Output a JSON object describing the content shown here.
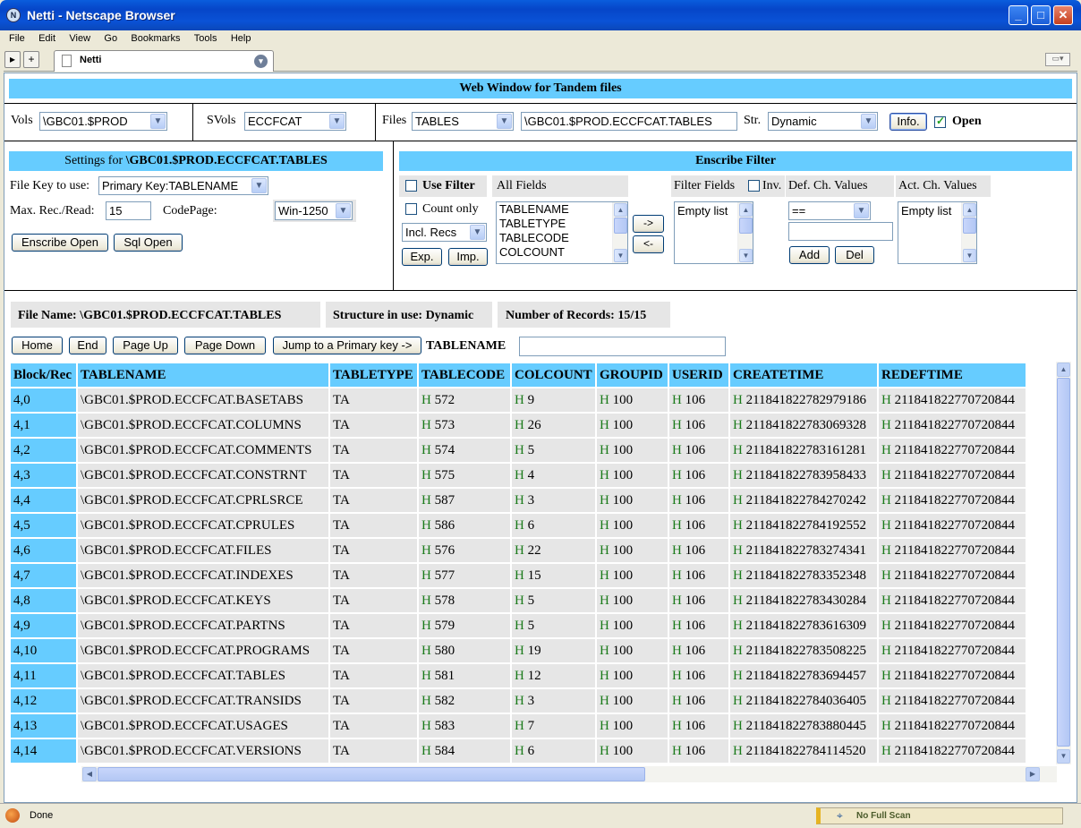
{
  "window": {
    "title": "Netti - Netscape Browser"
  },
  "menu": [
    "File",
    "Edit",
    "View",
    "Go",
    "Bookmarks",
    "Tools",
    "Help"
  ],
  "tab": {
    "label": "Netti"
  },
  "page": {
    "header": "Web Window for Tandem files",
    "vols": {
      "label": "Vols",
      "value": "\\GBC01.$PROD"
    },
    "svols": {
      "label": "SVols",
      "value": "ECCFCAT"
    },
    "files": {
      "label": "Files",
      "value": "TABLES",
      "path": "\\GBC01.$PROD.ECCFCAT.TABLES"
    },
    "structure": {
      "label": "Str.",
      "value": "Dynamic"
    },
    "info_label": "Info.",
    "open_label": "Open",
    "settings": {
      "title_prefix": "Settings for ",
      "title_file": "\\GBC01.$PROD.ECCFCAT.TABLES",
      "file_key_label": "File Key to use:",
      "file_key_value": "Primary Key:TABLENAME",
      "max_rec_label": "Max. Rec./Read:",
      "max_rec_value": "15",
      "codepage_label": "CodePage:",
      "codepage_value": "Win-1250",
      "enscribe_open": "Enscribe Open",
      "sql_open": "Sql Open"
    },
    "filter": {
      "title": "Enscribe Filter",
      "use_filter": "Use Filter",
      "all_fields": "All Fields",
      "count_only": "Count only",
      "incl_recs": "Incl. Recs",
      "exp": "Exp.",
      "imp": "Imp.",
      "fields": [
        "TABLENAME",
        "TABLETYPE",
        "TABLECODE",
        "COLCOUNT"
      ],
      "move_right": "->",
      "move_left": "<-",
      "filter_fields": "Filter Fields",
      "inv": "Inv.",
      "empty_list": "Empty list",
      "def_ch_values": "Def. Ch. Values",
      "operator": "==",
      "add": "Add",
      "del": "Del",
      "act_ch_values": "Act. Ch. Values"
    },
    "info_bar": {
      "file_name": "File Name: \\GBC01.$PROD.ECCFCAT.TABLES",
      "structure": "Structure in use: Dynamic",
      "records": "Number of Records: 15/15"
    },
    "nav": {
      "home": "Home",
      "end": "End",
      "page_up": "Page Up",
      "page_down": "Page Down",
      "jump": "Jump to a Primary key ->",
      "key_name": "TABLENAME"
    },
    "table": {
      "columns": [
        "Block/Rec",
        "TABLENAME",
        "TABLETYPE",
        "TABLECODE",
        "COLCOUNT",
        "GROUPID",
        "USERID",
        "CREATETIME",
        "REDEFTIME"
      ],
      "rows": [
        [
          "4,0",
          "\\GBC01.$PROD.ECCFCAT.BASETABS",
          "TA",
          "572",
          "9",
          "100",
          "106",
          "211841822782979186",
          "211841822770720844"
        ],
        [
          "4,1",
          "\\GBC01.$PROD.ECCFCAT.COLUMNS",
          "TA",
          "573",
          "26",
          "100",
          "106",
          "211841822783069328",
          "211841822770720844"
        ],
        [
          "4,2",
          "\\GBC01.$PROD.ECCFCAT.COMMENTS",
          "TA",
          "574",
          "5",
          "100",
          "106",
          "211841822783161281",
          "211841822770720844"
        ],
        [
          "4,3",
          "\\GBC01.$PROD.ECCFCAT.CONSTRNT",
          "TA",
          "575",
          "4",
          "100",
          "106",
          "211841822783958433",
          "211841822770720844"
        ],
        [
          "4,4",
          "\\GBC01.$PROD.ECCFCAT.CPRLSRCE",
          "TA",
          "587",
          "3",
          "100",
          "106",
          "211841822784270242",
          "211841822770720844"
        ],
        [
          "4,5",
          "\\GBC01.$PROD.ECCFCAT.CPRULES",
          "TA",
          "586",
          "6",
          "100",
          "106",
          "211841822784192552",
          "211841822770720844"
        ],
        [
          "4,6",
          "\\GBC01.$PROD.ECCFCAT.FILES",
          "TA",
          "576",
          "22",
          "100",
          "106",
          "211841822783274341",
          "211841822770720844"
        ],
        [
          "4,7",
          "\\GBC01.$PROD.ECCFCAT.INDEXES",
          "TA",
          "577",
          "15",
          "100",
          "106",
          "211841822783352348",
          "211841822770720844"
        ],
        [
          "4,8",
          "\\GBC01.$PROD.ECCFCAT.KEYS",
          "TA",
          "578",
          "5",
          "100",
          "106",
          "211841822783430284",
          "211841822770720844"
        ],
        [
          "4,9",
          "\\GBC01.$PROD.ECCFCAT.PARTNS",
          "TA",
          "579",
          "5",
          "100",
          "106",
          "211841822783616309",
          "211841822770720844"
        ],
        [
          "4,10",
          "\\GBC01.$PROD.ECCFCAT.PROGRAMS",
          "TA",
          "580",
          "19",
          "100",
          "106",
          "211841822783508225",
          "211841822770720844"
        ],
        [
          "4,11",
          "\\GBC01.$PROD.ECCFCAT.TABLES",
          "TA",
          "581",
          "12",
          "100",
          "106",
          "211841822783694457",
          "211841822770720844"
        ],
        [
          "4,12",
          "\\GBC01.$PROD.ECCFCAT.TRANSIDS",
          "TA",
          "582",
          "3",
          "100",
          "106",
          "211841822784036405",
          "211841822770720844"
        ],
        [
          "4,13",
          "\\GBC01.$PROD.ECCFCAT.USAGES",
          "TA",
          "583",
          "7",
          "100",
          "106",
          "211841822783880445",
          "211841822770720844"
        ],
        [
          "4,14",
          "\\GBC01.$PROD.ECCFCAT.VERSIONS",
          "TA",
          "584",
          "6",
          "100",
          "106",
          "211841822784114520",
          "211841822770720844"
        ]
      ],
      "hex_prefix": "H"
    }
  },
  "status": {
    "text": "Done",
    "scan": "No Full Scan"
  }
}
